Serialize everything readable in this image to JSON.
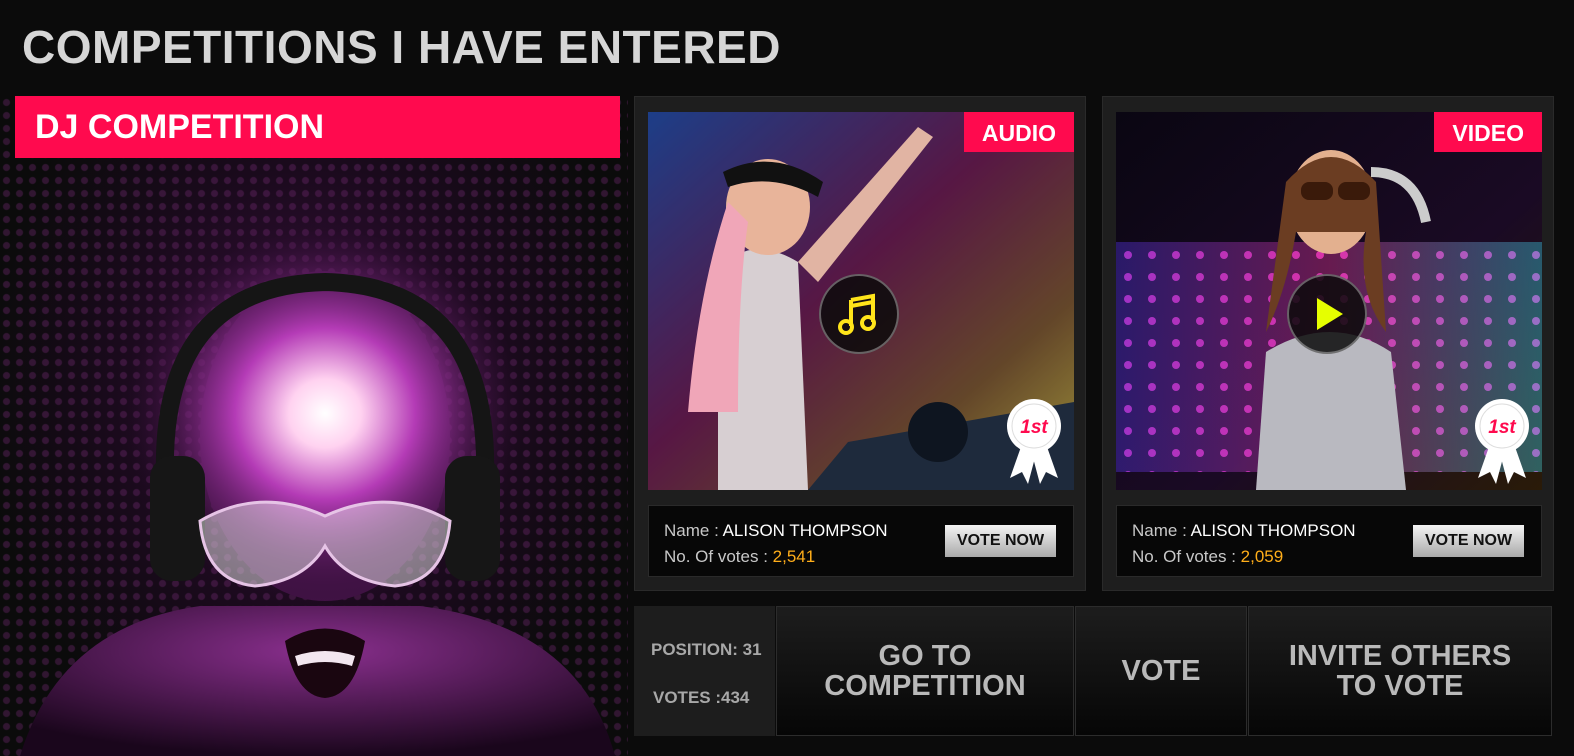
{
  "page": {
    "title": "COMPETITIONS I HAVE ENTERED"
  },
  "hero": {
    "banner": "DJ COMPETITION"
  },
  "cards": [
    {
      "badge": "AUDIO",
      "media_icon": "music-note-icon",
      "rank": "1st",
      "name_label": "Name : ",
      "name": "ALISON THOMPSON",
      "votes_label": "No. Of votes : ",
      "votes": "2,541",
      "vote_button": "VOTE NOW"
    },
    {
      "badge": "VIDEO",
      "media_icon": "play-icon",
      "rank": "1st",
      "name_label": "Name : ",
      "name": "ALISON THOMPSON",
      "votes_label": "No. Of votes : ",
      "votes": "2,059",
      "vote_button": "VOTE NOW"
    }
  ],
  "stats": {
    "position": "POSITION: 31",
    "votes": "VOTES :434"
  },
  "actions": {
    "go_to_competition": "GO TO\nCOMPETITION",
    "vote": "VOTE",
    "invite": "INVITE OTHERS\nTO VOTE"
  },
  "colors": {
    "accent": "#ff0a4e",
    "votes": "#ffae1a",
    "background": "#0b0b0b"
  }
}
